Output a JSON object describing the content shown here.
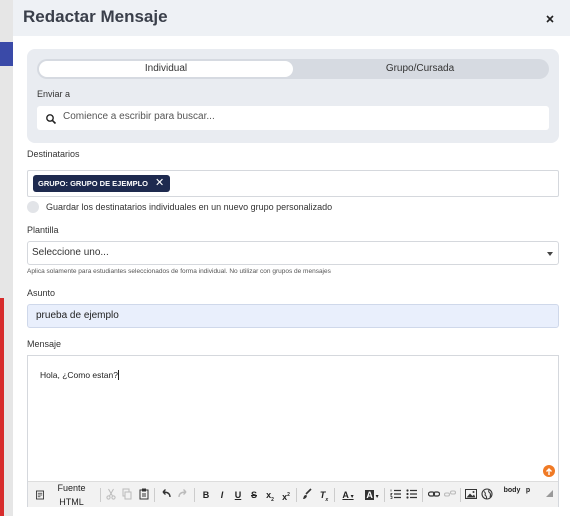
{
  "modal": {
    "title": "Redactar Mensaje",
    "close_label": "×"
  },
  "tabs": [
    {
      "label": "Individual",
      "active": true
    },
    {
      "label": "Grupo/Cursada",
      "active": false
    }
  ],
  "send_to": {
    "label": "Enviar a",
    "placeholder": "Comience a escribir para buscar..."
  },
  "recipients": {
    "label": "Destinatarios",
    "chips": [
      {
        "label": "GRUPO: GRUPO DE EJEMPLO",
        "remove": "✕"
      }
    ]
  },
  "save_group": {
    "label": "Guardar los destinatarios individuales en un nuevo grupo personalizado",
    "checked": false
  },
  "template": {
    "label": "Plantilla",
    "selected": "Seleccione uno...",
    "hint": "Aplica solamente para estudiantes seleccionados de forma individual. No utilizar con grupos de mensajes"
  },
  "subject": {
    "label": "Asunto",
    "value": "prueba de ejemplo"
  },
  "message": {
    "label": "Mensaje",
    "body": "Hola, ¿Como estan?"
  },
  "toolbar": {
    "source_label": "Fuente HTML",
    "bold": "B",
    "italic": "I",
    "underline": "U",
    "strike": "S",
    "subscript": "x",
    "superscript": "x",
    "clear": "T",
    "font_color": "A",
    "bg_color": "A",
    "path_body": "body",
    "path_p": "p"
  },
  "colors": {
    "header_bg": "#eef1f5",
    "chip_bg": "#1e2a4f",
    "subject_bg": "#e9effc",
    "accent_orange": "#f07a25"
  }
}
